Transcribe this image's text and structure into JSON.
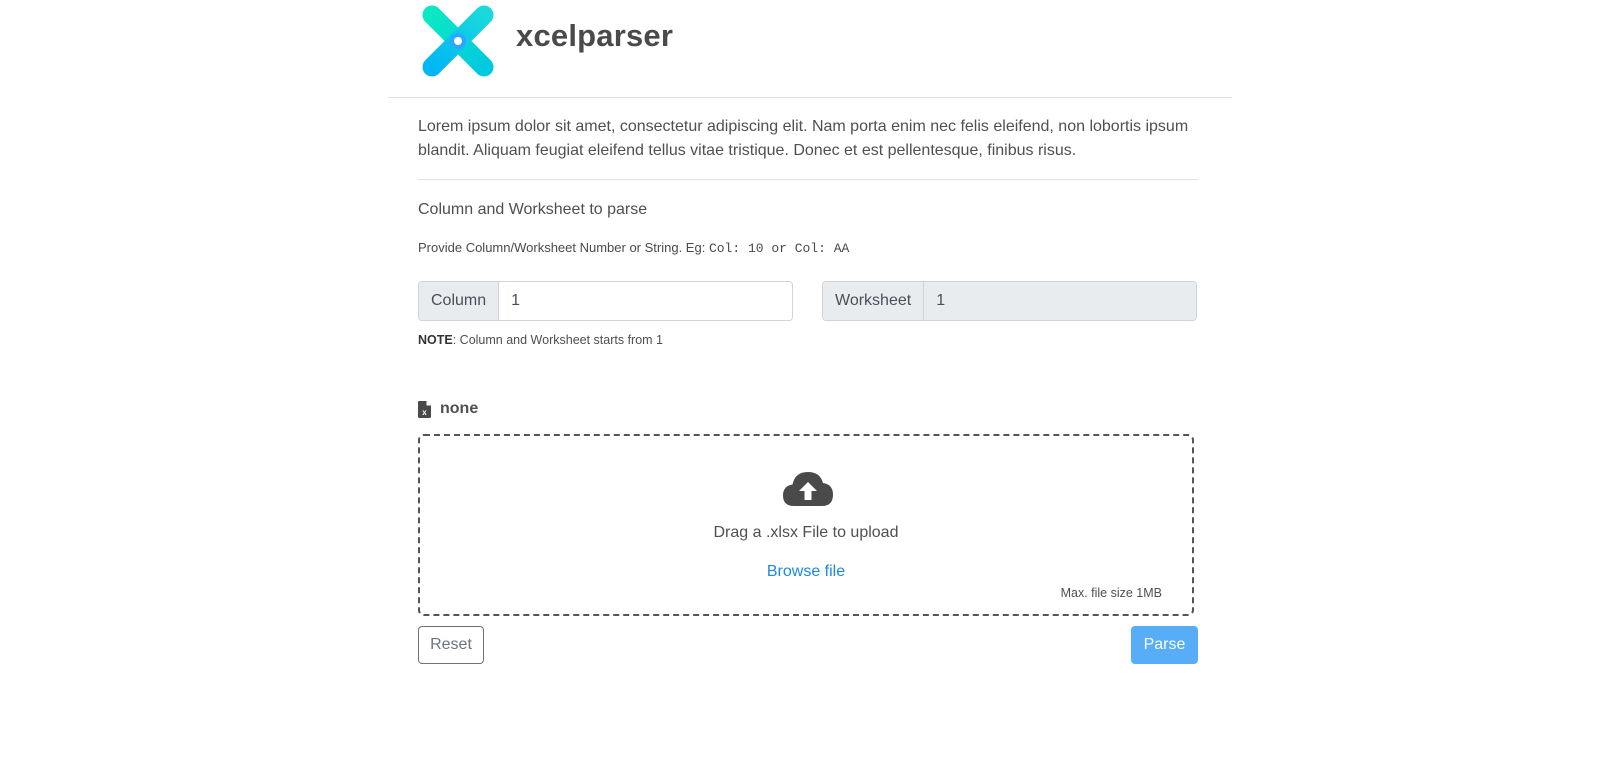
{
  "header": {
    "brand": "xcelparser",
    "logo_icon": "x-logo-icon",
    "logo_colors": [
      "#0ad6c8",
      "#00bff3",
      "#29a8ff"
    ]
  },
  "main": {
    "intro": "Lorem ipsum dolor sit amet, consectetur adipiscing elit. Nam porta enim nec felis eleifend, non lobortis ipsum blandit. Aliquam feugiat eleifend tellus vitae tristique. Donec et est pellentesque, finibus risus.",
    "section_title": "Column and Worksheet to parse",
    "hint_prefix": "Provide Column/Worksheet Number or String. Eg: ",
    "hint_code": "Col: 10 or Col: AA",
    "column": {
      "label": "Column",
      "value": "1"
    },
    "worksheet": {
      "label": "Worksheet",
      "value": "1"
    },
    "note_bold": "NOTE",
    "note_text": ": Column and Worksheet starts from 1",
    "file": {
      "icon": "excel-file-icon",
      "name": "none"
    },
    "dropzone": {
      "icon": "cloud-upload-icon",
      "drag_text": "Drag a .xlsx File to upload",
      "browse_label": "Browse file",
      "max_size": "Max. file size 1MB"
    },
    "actions": {
      "reset_label": "Reset",
      "parse_label": "Parse"
    }
  },
  "colors": {
    "accent": "#1e88e5",
    "parse_button": "#58adf7",
    "text": "#4f4f4f"
  }
}
